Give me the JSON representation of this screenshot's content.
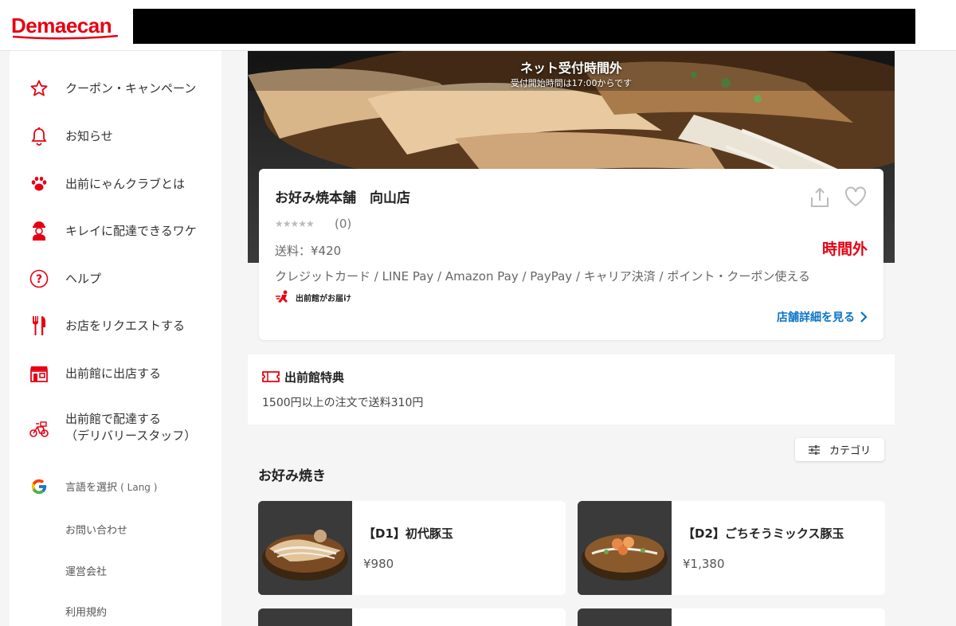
{
  "header": {
    "logo": "Demaecan"
  },
  "colors": {
    "brand": "#e60012",
    "link": "#0a73c6"
  },
  "sidebar": {
    "items": [
      {
        "label": "クーポン・キャンペーン",
        "icon": "star-icon"
      },
      {
        "label": "お知らせ",
        "icon": "bell-icon"
      },
      {
        "label": "出前にゃんクラブとは",
        "icon": "paw-icon"
      },
      {
        "label": "キレイに配達できるワケ",
        "icon": "delivery-person-icon"
      },
      {
        "label": "ヘルプ",
        "icon": "help-icon"
      },
      {
        "label": "お店をリクエストする",
        "icon": "fork-knife-icon"
      },
      {
        "label": "出前館に出店する",
        "icon": "storefront-icon"
      },
      {
        "label": "出前館で配達する\n（デリバリースタッフ）",
        "icon": "bicycle-icon"
      }
    ],
    "language": "言語を選択",
    "language_sub": "( Lang )",
    "links": [
      "お問い合わせ",
      "運営会社",
      "利用規約"
    ]
  },
  "hero": {
    "title": "ネット受付時間外",
    "subtitle": "受付開始時間は17:00からです"
  },
  "shop": {
    "name": "お好み焼本舗　向山店",
    "stars": "★★★★★",
    "rating_count": "(0)",
    "fee": "送料：¥420",
    "status": "時間外",
    "payments": "クレジットカード / LINE Pay / Amazon Pay / PayPay / キャリア決済 / ポイント・クーポン使える",
    "delivery": "出前館がお届け",
    "detail_link": "店舗詳細を見る"
  },
  "perk": {
    "title": "出前館特典",
    "text": "1500円以上の注文で送料310円"
  },
  "category_button": "カテゴリ",
  "section": {
    "title": "お好み焼き"
  },
  "menu": [
    {
      "name": "【D1】初代豚玉",
      "price": "¥980"
    },
    {
      "name": "【D2】ごちそうミックス豚玉",
      "price": "¥1,380"
    }
  ]
}
